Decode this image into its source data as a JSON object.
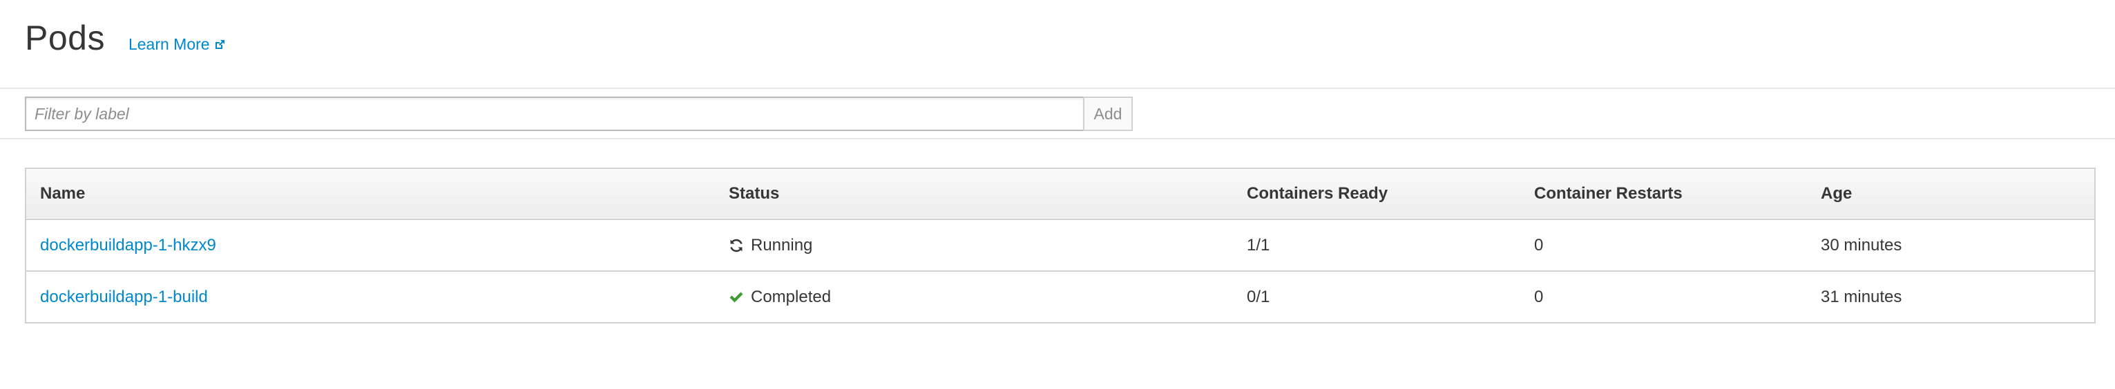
{
  "header": {
    "title": "Pods",
    "learn_more": "Learn More"
  },
  "filter": {
    "placeholder": "Filter by label",
    "add_label": "Add"
  },
  "table": {
    "columns": [
      "Name",
      "Status",
      "Containers Ready",
      "Container Restarts",
      "Age"
    ],
    "rows": [
      {
        "name": "dockerbuildapp-1-hkzx9",
        "status": "Running",
        "status_icon": "refresh-icon",
        "containers_ready": "1/1",
        "restarts": "0",
        "age": "30 minutes"
      },
      {
        "name": "dockerbuildapp-1-build",
        "status": "Completed",
        "status_icon": "checkmark-icon",
        "status_color": "#3f9c35",
        "containers_ready": "0/1",
        "restarts": "0",
        "age": "31 minutes"
      }
    ]
  },
  "colors": {
    "link": "#0088ce",
    "text": "#363636",
    "success": "#3f9c35"
  }
}
